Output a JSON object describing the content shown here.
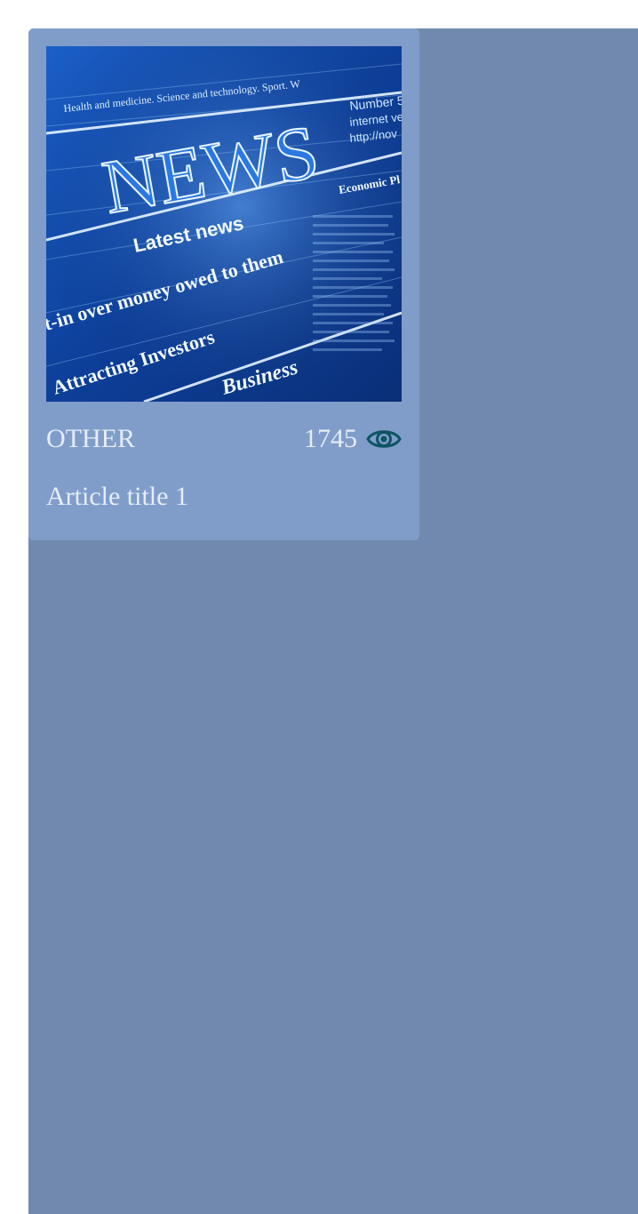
{
  "colors": {
    "panel": "#7189ae",
    "card": "#809dca",
    "text": "#e6ecf6",
    "eye_icon": "#0d5563"
  },
  "article": {
    "category": "OTHER",
    "views": "1745",
    "views_icon": "eye-icon",
    "title": "Article title 1",
    "image": {
      "masthead": "NEWS",
      "subhead": "Latest news",
      "headlines": [
        "t-in over money owed to them",
        "Attracting Investors",
        "Business",
        "Economic Pl"
      ],
      "banner": "Health and medicine. Science and technology. Sport. W",
      "side_text": [
        "Number 5",
        "internet ve",
        "http://nov"
      ]
    }
  }
}
